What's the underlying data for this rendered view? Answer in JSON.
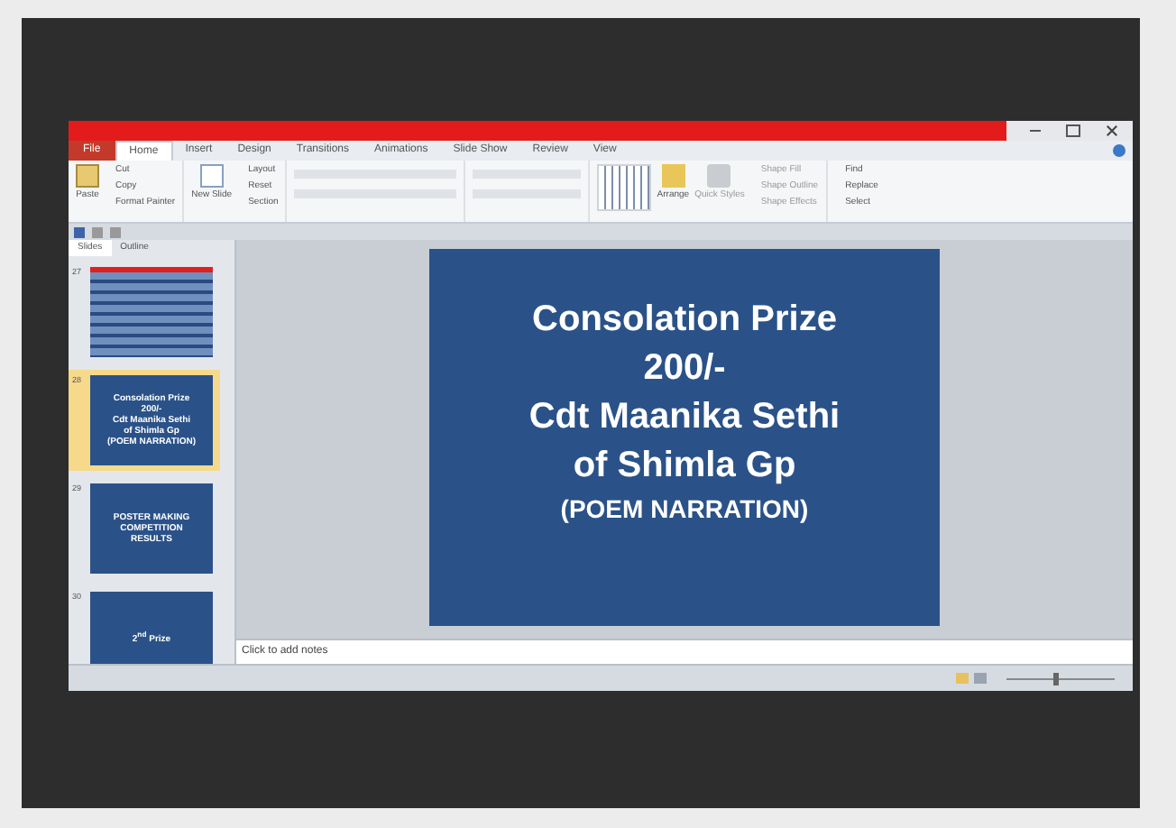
{
  "ribbon_tabs": [
    {
      "label": "File",
      "kind": "file",
      "selected": false
    },
    {
      "label": "Home",
      "kind": "tab",
      "selected": true
    },
    {
      "label": "Insert",
      "kind": "tab",
      "selected": false
    },
    {
      "label": "Design",
      "kind": "tab",
      "selected": false
    },
    {
      "label": "Transitions",
      "kind": "tab",
      "selected": false
    },
    {
      "label": "Animations",
      "kind": "tab",
      "selected": false
    },
    {
      "label": "Slide Show",
      "kind": "tab",
      "selected": false
    },
    {
      "label": "Review",
      "kind": "tab",
      "selected": false
    },
    {
      "label": "View",
      "kind": "tab",
      "selected": false
    }
  ],
  "ribbon": {
    "clipboard": {
      "paste": "Paste",
      "items": [
        "Cut",
        "Copy",
        "Format Painter"
      ]
    },
    "slides": {
      "new_slide": "New Slide",
      "items": [
        "Layout",
        "Reset",
        "Section"
      ]
    },
    "drawing": {
      "arrange": "Arrange",
      "quick_styles": "Quick Styles",
      "items": [
        "Shape Fill",
        "Shape Outline",
        "Shape Effects"
      ]
    },
    "editing": {
      "items": [
        "Find",
        "Replace",
        "Select"
      ]
    }
  },
  "panel_tabs": [
    {
      "label": "Slides",
      "selected": true
    },
    {
      "label": "Outline",
      "selected": false
    }
  ],
  "thumbnails": [
    {
      "number": "27",
      "kind": "table",
      "selected": false
    },
    {
      "number": "28",
      "kind": "text",
      "selected": true,
      "lines": [
        "Consolation Prize",
        "200/-",
        "Cdt Maanika Sethi",
        "of Shimla Gp",
        "(POEM NARRATION)"
      ]
    },
    {
      "number": "29",
      "kind": "text",
      "selected": false,
      "lines": [
        "POSTER MAKING",
        "COMPETITION",
        "RESULTS"
      ]
    },
    {
      "number": "30",
      "kind": "text",
      "selected": false,
      "lines": [
        "2$^{nd}$ Prize"
      ]
    }
  ],
  "slide": {
    "lines": [
      {
        "text": "Consolation Prize",
        "kind": "title"
      },
      {
        "text": "200/-",
        "kind": "title"
      },
      {
        "text": "Cdt Maanika Sethi",
        "kind": "title"
      },
      {
        "text": "of Shimla Gp",
        "kind": "title"
      },
      {
        "text": "(POEM NARRATION)",
        "kind": "subtitle"
      }
    ]
  },
  "notes": {
    "placeholder": "Click to add notes"
  },
  "status_bar": {
    "zoom": {
      "level": 0.45
    }
  }
}
